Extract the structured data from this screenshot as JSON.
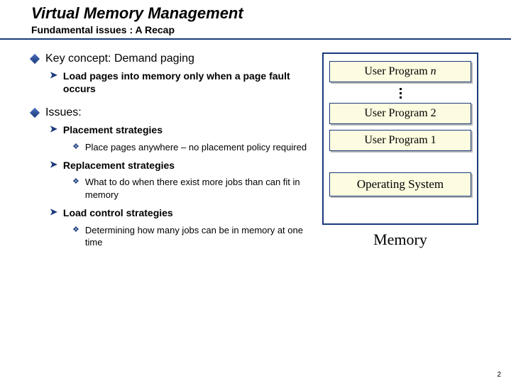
{
  "title": "Virtual Memory Management",
  "subtitle": "Fundamental issues : A Recap",
  "bullets": {
    "key_concept": "Key concept: Demand paging",
    "key_concept_sub": "Load pages into memory only when a page fault occurs",
    "issues": "Issues:",
    "placement": "Placement strategies",
    "placement_sub": "Place pages anywhere – no placement policy required",
    "replacement": "Replacement strategies",
    "replacement_sub": "What to do when there exist more jobs than can fit in memory",
    "loadctrl": "Load control strategies",
    "loadctrl_sub": "Determining how many jobs can be in memory at one time"
  },
  "mem": {
    "progN_a": "User Program ",
    "progN_b": "n",
    "prog2": "User Program 2",
    "prog1": "User Program 1",
    "os": "Operating System",
    "label": "Memory"
  },
  "page_number": "2"
}
